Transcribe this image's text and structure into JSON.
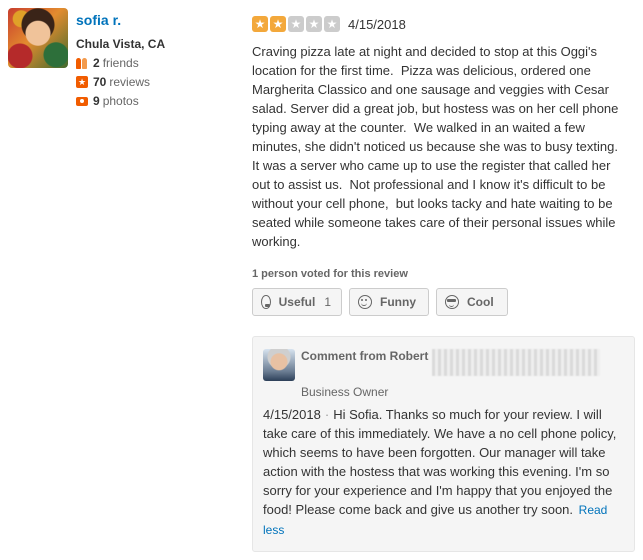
{
  "reviewer": {
    "name": "sofia r.",
    "location": "Chula Vista, CA",
    "friends_count": "2",
    "friends_label": "friends",
    "reviews_count": "70",
    "reviews_label": "reviews",
    "photos_count": "9",
    "photos_label": "photos"
  },
  "review": {
    "rating": 2,
    "rating_max": 5,
    "date": "4/15/2018",
    "text": "Craving pizza late at night and decided to stop at this Oggi's location for the first time.  Pizza was delicious, ordered one Margherita Classico and one sausage and veggies with Cesar salad. Server did a great job, but hostess was on her cell phone typing away at the counter.  We walked in an waited a few minutes, she didn't noticed us because she was to busy texting.  It was a server who came up to use the register that called her out to assist us.  Not professional and I know it's difficult to be without your cell phone,  but looks tacky and hate waiting to be seated while someone takes care of their personal issues while working.",
    "votes_summary": "1 person voted for this review",
    "buttons": {
      "useful_label": "Useful",
      "useful_count": "1",
      "funny_label": "Funny",
      "cool_label": "Cool"
    }
  },
  "owner_comment": {
    "title_prefix": "Comment from Robert",
    "role": "Business Owner",
    "date": "4/15/2018",
    "separator": "·",
    "text": "Hi Sofia. Thanks so much for your review. I will take care of this immediately. We have a no cell phone policy, which seems to have been forgotten. Our manager will take action with the hostess that was working this evening. I'm so sorry for your experience and I'm happy that you enjoyed the food! Please come back and give us another try soon.",
    "read_less": "Read less"
  },
  "colors": {
    "link": "#0073bb",
    "star_on": "#f3a83b",
    "star_off": "#cccccc",
    "stat_icon": "#f15c00"
  },
  "icons": [
    "friends-icon",
    "reviews-icon",
    "photos-icon",
    "star-icon",
    "useful-icon",
    "funny-icon",
    "cool-icon"
  ]
}
